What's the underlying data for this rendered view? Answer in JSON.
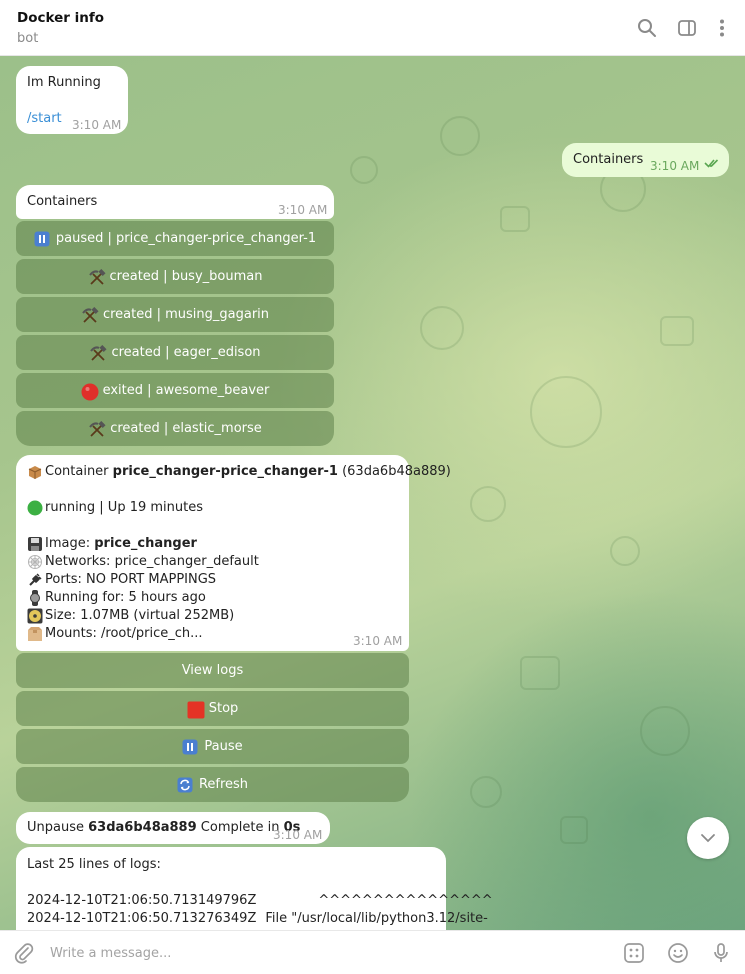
{
  "header": {
    "title": "Docker info",
    "subtitle": "bot",
    "icons": [
      "search-icon",
      "sidebar-toggle-icon",
      "more-vertical-icon"
    ]
  },
  "messages": {
    "m1": {
      "text": "Im Running",
      "link": "/start",
      "time": "3:10 AM"
    },
    "m2": {
      "text": "Containers",
      "time": "3:10 AM",
      "status": "double-check-icon"
    },
    "m3": {
      "text": "Containers",
      "time": "3:10 AM"
    },
    "m4": {
      "time": "3:10 AM",
      "l1_prefix": "Container",
      "l1_name": "price_changer-price_changer-1",
      "l1_id": "(63da6b48a889)",
      "l2": "running | Up 19 minutes",
      "image_label": "Image:",
      "image_value": "price_changer",
      "networks": "Networks: price_changer_default",
      "ports": "Ports: NO PORT MAPPINGS",
      "running_for": "Running for: 5 hours ago",
      "size": "Size: 1.07MB (virtual 252MB)",
      "mounts": "Mounts: /root/price_ch..."
    },
    "m5": {
      "prefix": "Unpause",
      "id": "63da6b48a889",
      "mid": "Complete in",
      "dur": "0s",
      "time": "3:10 AM"
    },
    "m6": {
      "title": "Last 25 lines of logs:",
      "line1_ts": "2024-12-10T21:06:50.713149796Z",
      "line1_rest": "^^^^^^^^^^^^^^^^",
      "line2_ts": "2024-12-10T21:06:50.713276349Z",
      "line2_rest": "File \"/usr/local/lib/python3.12/site-"
    }
  },
  "containers_keyboard": [
    {
      "label": "paused | price_changer-price_changer-1",
      "icon": "pause-icon"
    },
    {
      "label": "created | busy_bouman",
      "icon": "hammer-pick-icon"
    },
    {
      "label": "created | musing_gagarin",
      "icon": "hammer-pick-icon"
    },
    {
      "label": "created | eager_edison",
      "icon": "hammer-pick-icon"
    },
    {
      "label": "exited | awesome_beaver",
      "icon": "red-circle-icon"
    },
    {
      "label": "created | elastic_morse",
      "icon": "hammer-pick-icon"
    }
  ],
  "actions_keyboard": [
    {
      "label": "View logs",
      "icon": ""
    },
    {
      "label": "Stop",
      "icon": "stop-square-icon"
    },
    {
      "label": "Pause",
      "icon": "pause-icon"
    },
    {
      "label": "Refresh",
      "icon": "refresh-icon"
    }
  ],
  "composer": {
    "placeholder": "Write a message...",
    "icons": [
      "attach-icon",
      "bot-commands-icon",
      "emoji-icon",
      "microphone-icon"
    ]
  },
  "colors": {
    "link": "#3a8fd6",
    "outgoing_bubble": "#e9fbd7",
    "keyboard_button": "#6e8f5a",
    "running_dot": "#3cb043",
    "exited_dot": "#e0302a",
    "stop_square": "#e43325",
    "pause_blue": "#4a7fd0"
  }
}
